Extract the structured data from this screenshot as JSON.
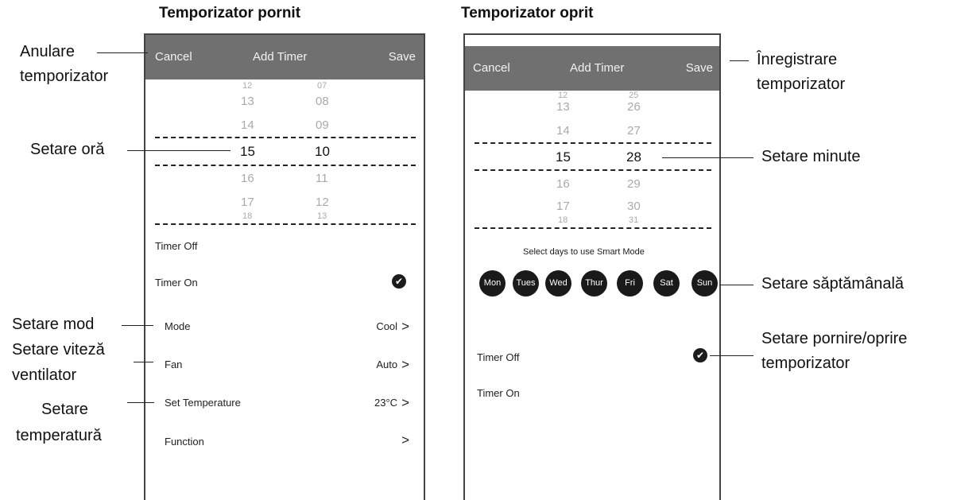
{
  "titles": {
    "left": "Temporizator pornit",
    "right": "Temporizator oprit"
  },
  "header": {
    "cancel": "Cancel",
    "title": "Add Timer",
    "save": "Save"
  },
  "left_picker": {
    "hours": [
      "12",
      "13",
      "14",
      "15",
      "16",
      "17",
      "18"
    ],
    "minutes": [
      "07",
      "08",
      "09",
      "10",
      "11",
      "12",
      "13"
    ]
  },
  "right_picker": {
    "hours": [
      "12",
      "13",
      "14",
      "15",
      "16",
      "17",
      "18"
    ],
    "minutes": [
      "25",
      "26",
      "27",
      "28",
      "29",
      "30",
      "31"
    ]
  },
  "left_screen": {
    "timer_off": "Timer Off",
    "timer_on": "Timer On",
    "checkmark": "✔",
    "mode_label": "Mode",
    "mode_value": "Cool",
    "fan_label": "Fan",
    "fan_value": "Auto",
    "temp_label": "Set Temperature",
    "temp_value": "23°C",
    "function_label": "Function",
    "chevron": ">"
  },
  "right_screen": {
    "days_caption": "Select days to use Smart Mode",
    "days": [
      "Mon",
      "Tues",
      "Wed",
      "Thur",
      "Fri",
      "Sat",
      "Sun"
    ],
    "timer_off": "Timer Off",
    "timer_on": "Timer On",
    "checkmark": "✔"
  },
  "callouts": {
    "cancel_l1": "Anulare",
    "cancel_l2": "temporizator",
    "hour": "Setare oră",
    "mode": "Setare mod",
    "fan_l1": "Setare viteză",
    "fan_l2": "ventilator",
    "temp_l1": "Setare",
    "temp_l2": "temperatură",
    "save_l1": "Înregistrare",
    "save_l2": "temporizator",
    "minute": "Setare minute",
    "weekly": "Setare săptămânală",
    "onoff_l1": "Setare pornire/oprire",
    "onoff_l2": "temporizator"
  },
  "colors": {
    "header_bg": "#707070",
    "header_text": "#f2f2f2",
    "day_bg": "#1a1a1a"
  }
}
